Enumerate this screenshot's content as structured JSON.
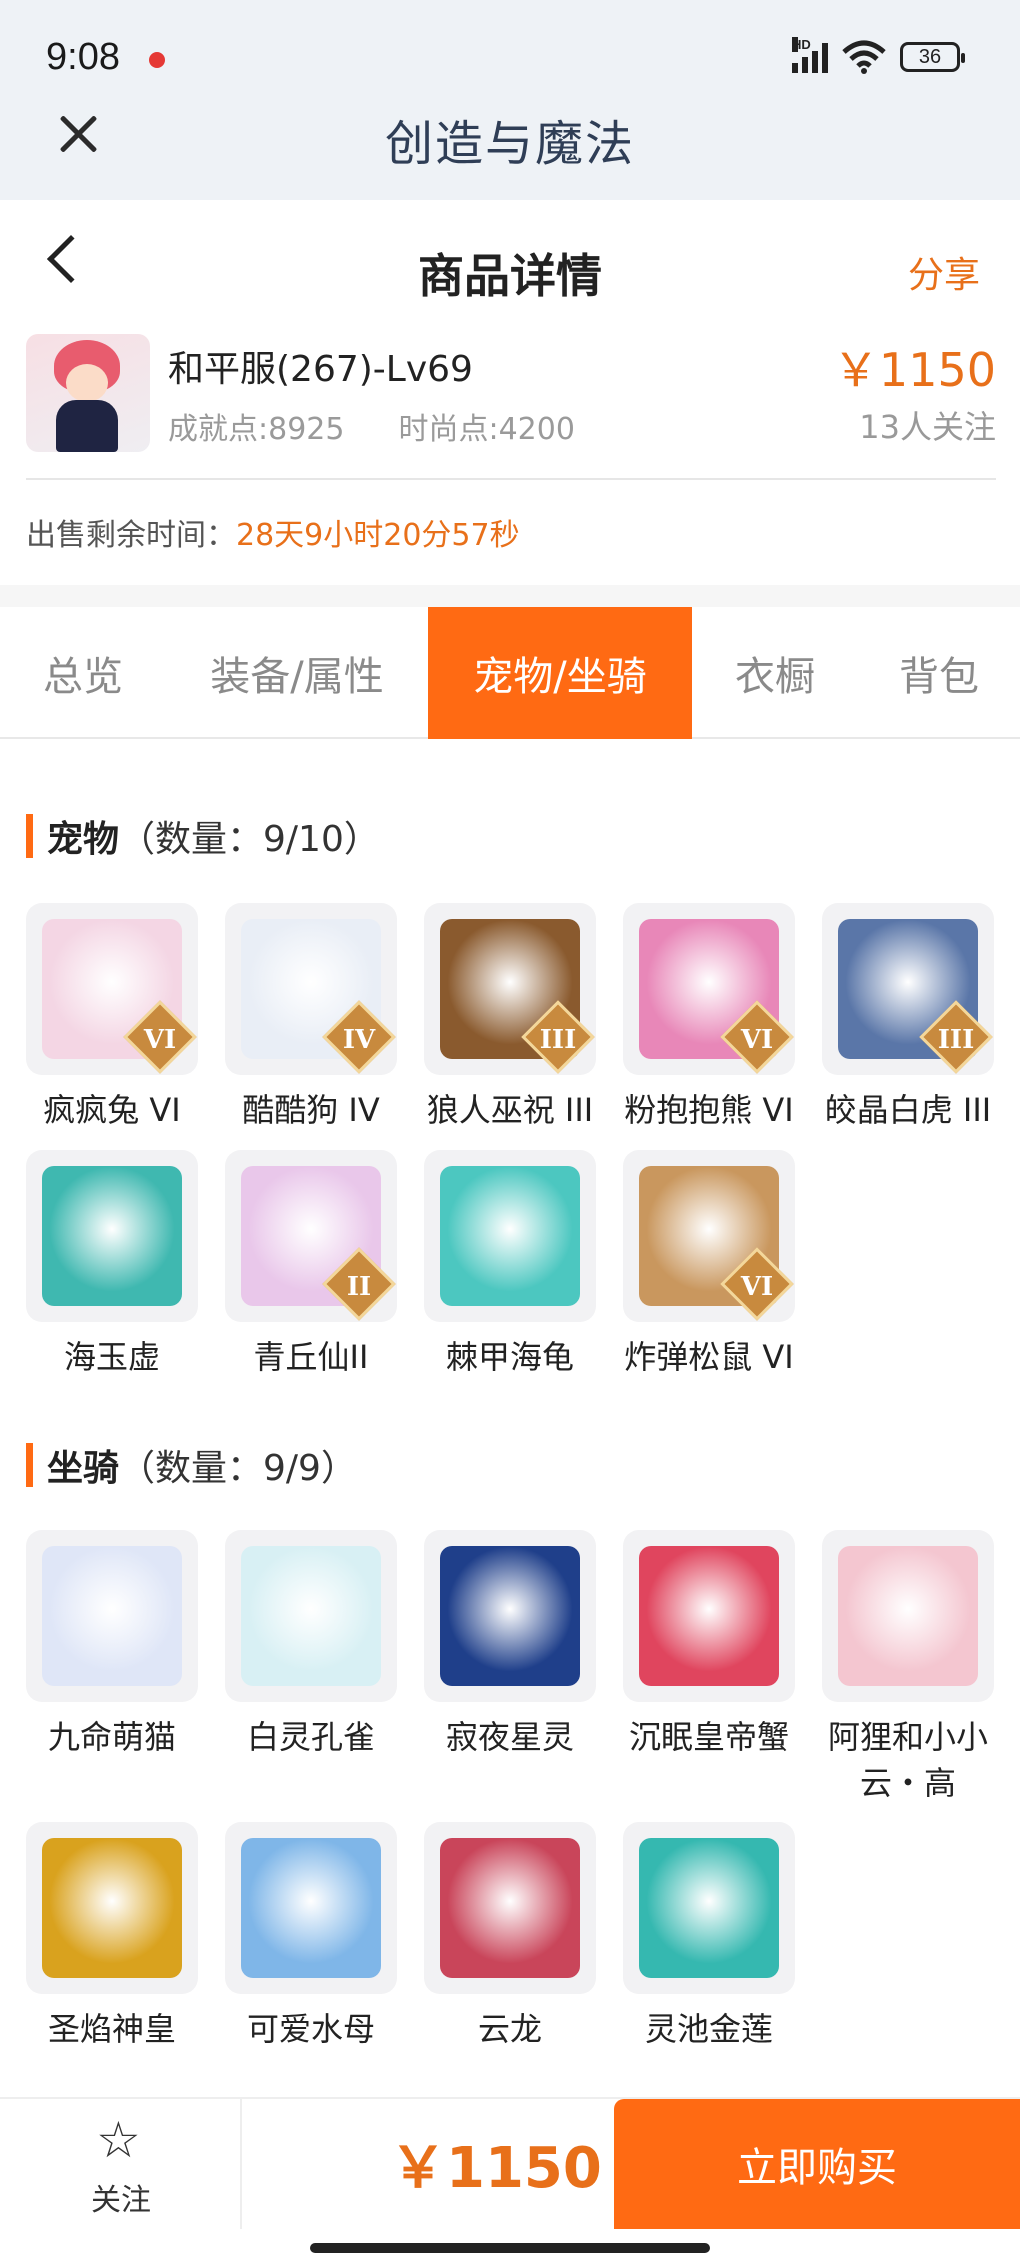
{
  "status_bar": {
    "time": "9:08",
    "network": "HD",
    "battery": "36"
  },
  "app": {
    "title": "创造与魔法"
  },
  "header": {
    "title": "商品详情",
    "share": "分享"
  },
  "product": {
    "name": "和平服(267)-Lv69",
    "achievement": "成就点:8925",
    "fashion": "时尚点:4200",
    "price": "￥1150",
    "followers": "13人关注"
  },
  "remaining": {
    "label": "出售剩余时间：",
    "value": "28天9小时20分57秒"
  },
  "tabs": [
    {
      "label": "总览",
      "active": false
    },
    {
      "label": "装备/属性",
      "active": false
    },
    {
      "label": "宠物/坐骑",
      "active": true
    },
    {
      "label": "衣橱",
      "active": false
    },
    {
      "label": "背包",
      "active": false
    }
  ],
  "pets": {
    "title": "宠物",
    "count": "（数量：9/10）",
    "items": [
      {
        "name": "疯疯兔 VI",
        "badge": "VI",
        "color": "#f4d6e4"
      },
      {
        "name": "酷酷狗 IV",
        "badge": "IV",
        "color": "#e9eef6"
      },
      {
        "name": "狼人巫祝 III",
        "badge": "III",
        "color": "#8a5a2e"
      },
      {
        "name": "粉抱抱熊 VI",
        "badge": "VI",
        "color": "#e887b8"
      },
      {
        "name": "皎晶白虎 III",
        "badge": "III",
        "color": "#5a76a8"
      },
      {
        "name": "海玉虚",
        "badge": "",
        "color": "#3fb8b0"
      },
      {
        "name": "青丘仙II",
        "badge": "II",
        "color": "#e9c7ea"
      },
      {
        "name": "棘甲海龟",
        "badge": "",
        "color": "#4cc7c0"
      },
      {
        "name": "炸弹松鼠 VI",
        "badge": "VI",
        "color": "#c9975e"
      }
    ]
  },
  "mounts": {
    "title": "坐骑",
    "count": "（数量：9/9）",
    "items": [
      {
        "name": "九命萌猫",
        "color": "#dfe6f7"
      },
      {
        "name": "白灵孔雀",
        "color": "#d8f0f4"
      },
      {
        "name": "寂夜星灵",
        "color": "#1f3f8a"
      },
      {
        "name": "沉眠皇帝蟹",
        "color": "#e0455e"
      },
      {
        "name": "阿狸和小小云・高",
        "color": "#f4c6d0"
      },
      {
        "name": "圣焰神皇",
        "color": "#d9a21e"
      },
      {
        "name": "可爱水母",
        "color": "#7fb6e8"
      },
      {
        "name": "云龙",
        "color": "#c9455a"
      },
      {
        "name": "灵池金莲",
        "color": "#35b8b0"
      }
    ]
  },
  "bottom_bar": {
    "follow": "关注",
    "price": "￥1150",
    "buy": "立即购买"
  },
  "colors": {
    "accent": "#ff6a13",
    "price": "#e8701a"
  }
}
